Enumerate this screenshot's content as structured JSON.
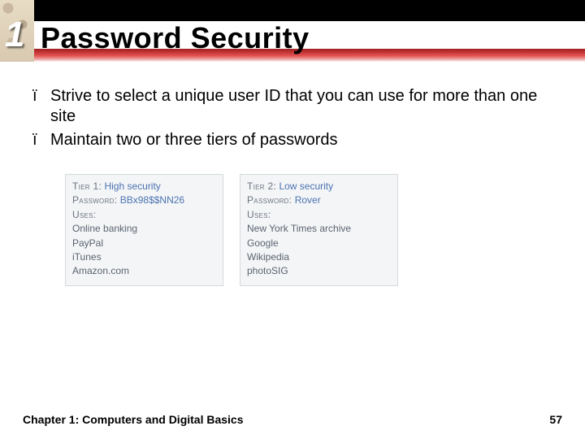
{
  "chapter_number": "1",
  "title": "Password Security",
  "bullets": [
    "Strive to select a unique user ID that you can use for more than one site",
    "Maintain two or three tiers of passwords"
  ],
  "bullet_marker": "ï",
  "tiers": [
    {
      "tier_label": "Tier 1:",
      "tier_desc": "High security",
      "password_label": "Password:",
      "password_value": "BBx98$$NN26",
      "uses_label": "Uses:",
      "uses": [
        "Online banking",
        "PayPal",
        "iTunes",
        "Amazon.com"
      ]
    },
    {
      "tier_label": "Tier 2:",
      "tier_desc": "Low security",
      "password_label": "Password:",
      "password_value": "Rover",
      "uses_label": "Uses:",
      "uses": [
        "New York Times archive",
        "Google",
        "Wikipedia",
        "photoSIG"
      ]
    }
  ],
  "footer": {
    "left": "Chapter 1: Computers and Digital Basics",
    "page": "57"
  }
}
